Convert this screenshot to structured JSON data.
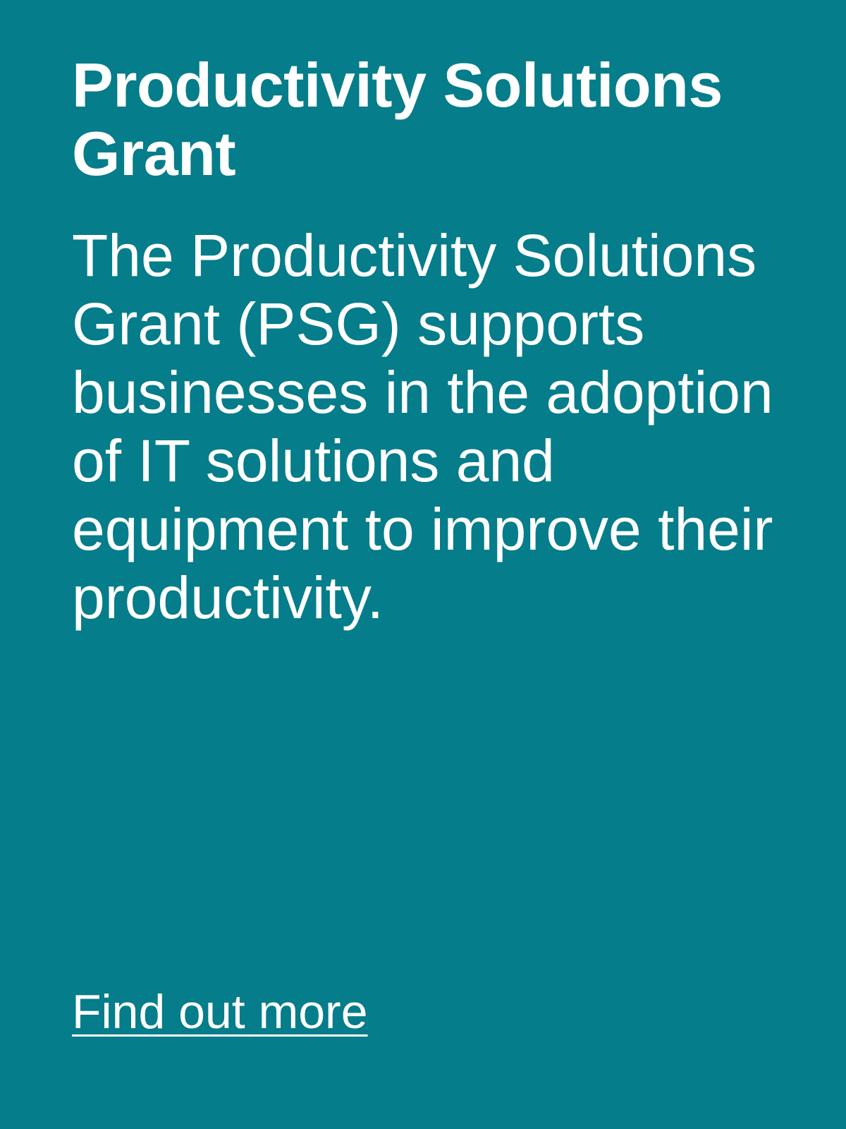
{
  "card": {
    "title": "Productivity Solutions Grant",
    "description": "The Productivity Solutions Grant (PSG) supports businesses in the adoption of IT solutions and equipment to improve their productivity.",
    "link_label": "Find out more"
  },
  "colors": {
    "background": "#057d8a",
    "text": "#ffffff"
  }
}
